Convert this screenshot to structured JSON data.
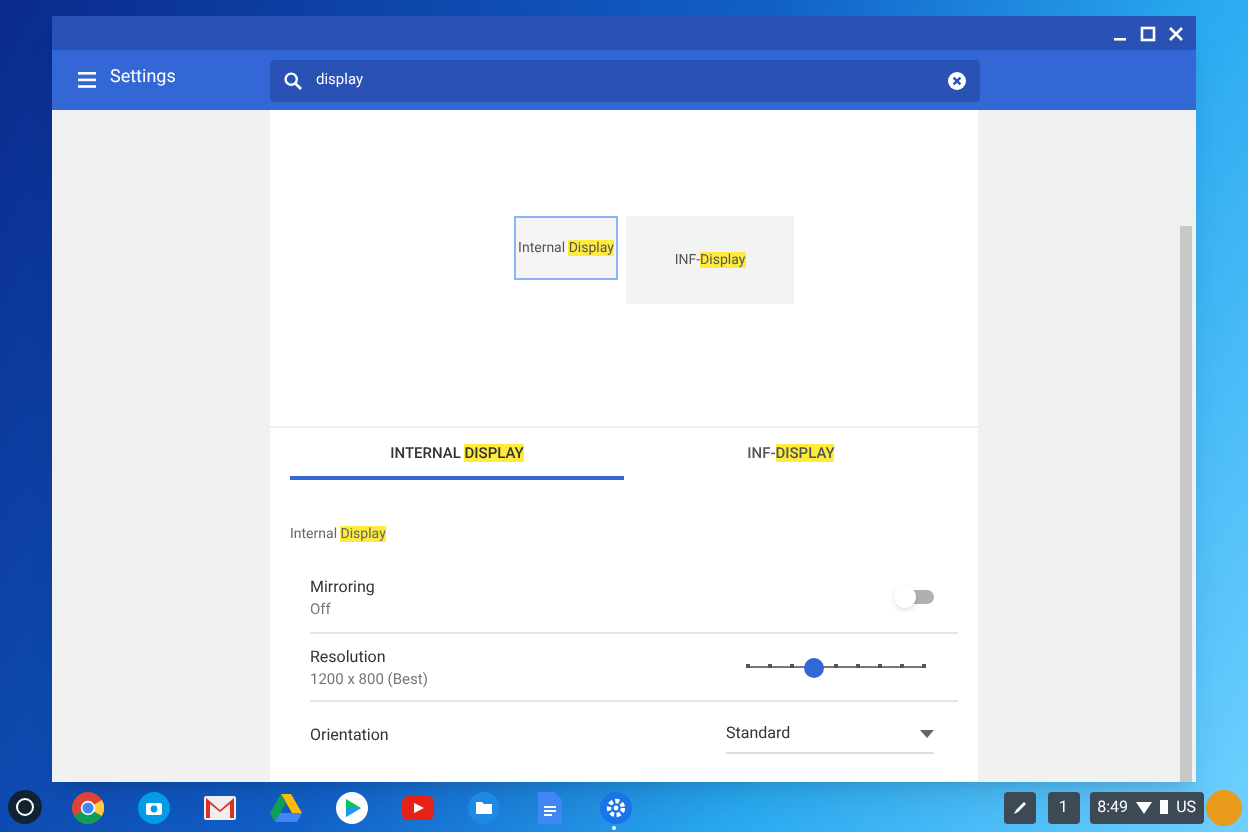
{
  "window": {
    "title": "Settings"
  },
  "search": {
    "value": "display"
  },
  "displays": [
    {
      "label": [
        {
          "text": "Internal ",
          "highlight": false
        },
        {
          "text": "Display",
          "highlight": true
        }
      ],
      "selected": true
    },
    {
      "label": [
        {
          "text": "INF-",
          "highlight": false
        },
        {
          "text": "Display",
          "highlight": true
        }
      ],
      "selected": false
    }
  ],
  "tabs": [
    {
      "label": [
        {
          "text": "INTERNAL ",
          "highlight": false
        },
        {
          "text": "DISPLAY",
          "highlight": true
        }
      ],
      "selected": true
    },
    {
      "label": [
        {
          "text": "INF-",
          "highlight": false
        },
        {
          "text": "DISPLAY",
          "highlight": true
        }
      ],
      "selected": false
    }
  ],
  "section_title": [
    {
      "text": "Internal ",
      "highlight": false
    },
    {
      "text": "Display",
      "highlight": true
    }
  ],
  "rows": [
    {
      "kind": "toggle",
      "label": "Mirroring",
      "value": "Off",
      "on": false
    },
    {
      "kind": "slider",
      "label": "Resolution",
      "value": "1200 x 800 (Best)",
      "level": 0.375
    },
    {
      "kind": "dropdown",
      "label": "Orientation",
      "value": "Standard"
    }
  ],
  "taskbar": {
    "apps": [
      {
        "kind": "browser",
        "active": false
      },
      {
        "kind": "camera",
        "active": false
      },
      {
        "kind": "mail",
        "active": false
      },
      {
        "kind": "drive",
        "active": false
      },
      {
        "kind": "play",
        "active": false
      },
      {
        "kind": "video",
        "active": false
      },
      {
        "kind": "files",
        "active": false
      },
      {
        "kind": "docs",
        "active": false
      },
      {
        "kind": "settings",
        "active": true
      }
    ],
    "desk_number": "1",
    "time": "8:49",
    "keyboard": "US"
  }
}
